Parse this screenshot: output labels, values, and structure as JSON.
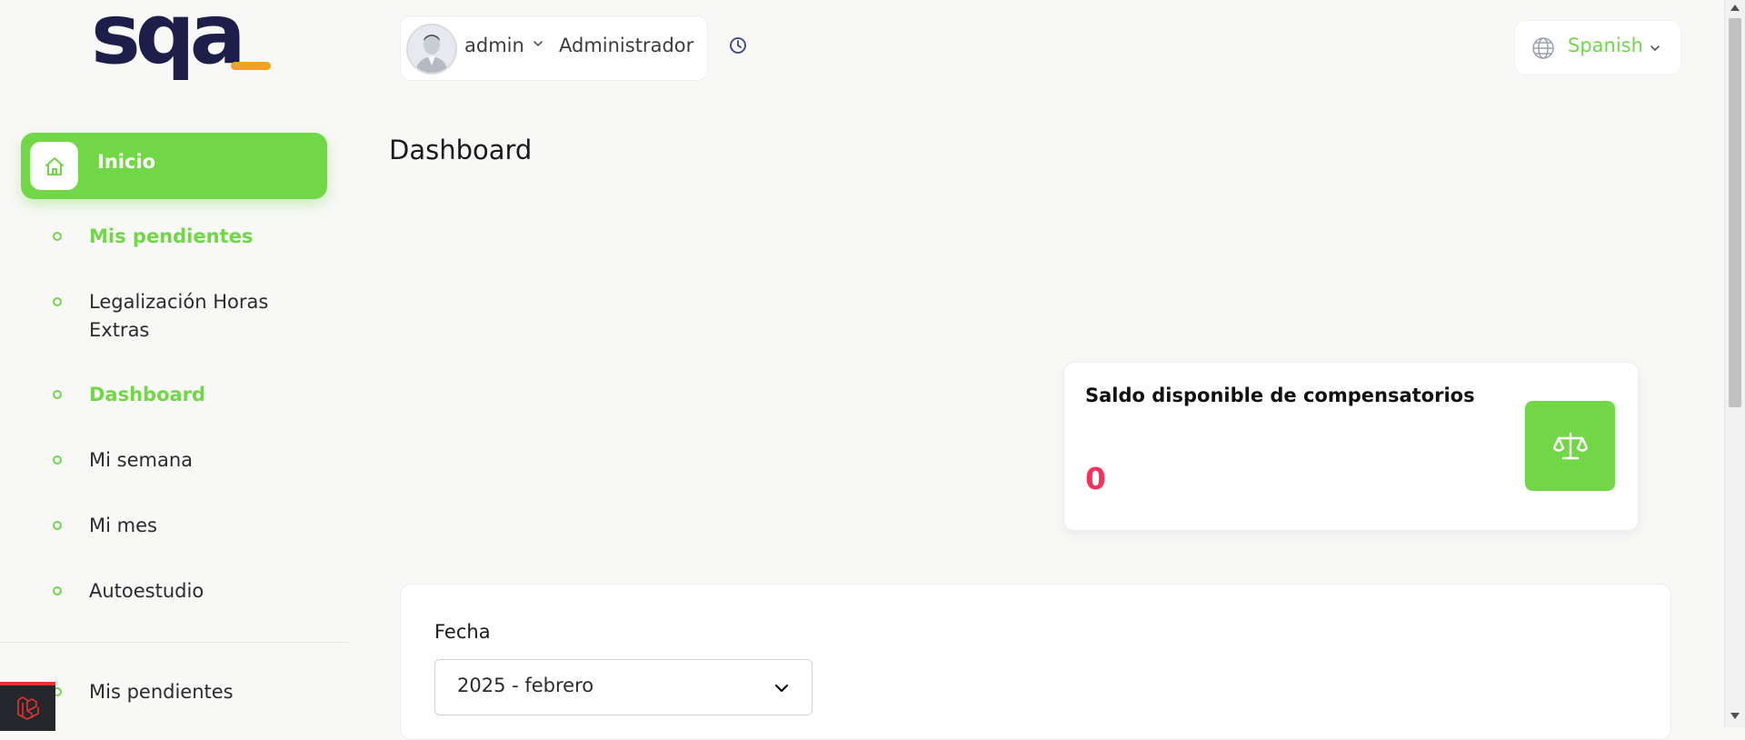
{
  "logo": {
    "text": "sqa",
    "accent_color": "#f2a223",
    "text_color": "#1d1f4a"
  },
  "sidebar": {
    "active_item": {
      "label": "Inicio",
      "icon": "home-icon"
    },
    "items": [
      {
        "label": "Mis pendientes",
        "active": true
      },
      {
        "label": "Legalización Horas Extras",
        "active": false
      },
      {
        "label": "Dashboard",
        "active": true
      },
      {
        "label": "Mi semana",
        "active": false
      },
      {
        "label": "Mi mes",
        "active": false
      },
      {
        "label": "Autoestudio",
        "active": false
      }
    ],
    "lower_items": [
      {
        "label": "Mis pendientes",
        "active": false
      }
    ]
  },
  "header": {
    "user": {
      "name": "admin",
      "role": "Administrador"
    },
    "language": {
      "label": "Spanish"
    }
  },
  "page": {
    "title": "Dashboard"
  },
  "stat_card": {
    "title": "Saldo disponible de compensatorios",
    "value": "0",
    "icon": "balance-scale-icon",
    "value_color": "#f3335e"
  },
  "filter": {
    "label": "Fecha",
    "selected": "2025 - febrero"
  },
  "colors": {
    "accent": "#71d746",
    "background": "#f8f8f7"
  }
}
